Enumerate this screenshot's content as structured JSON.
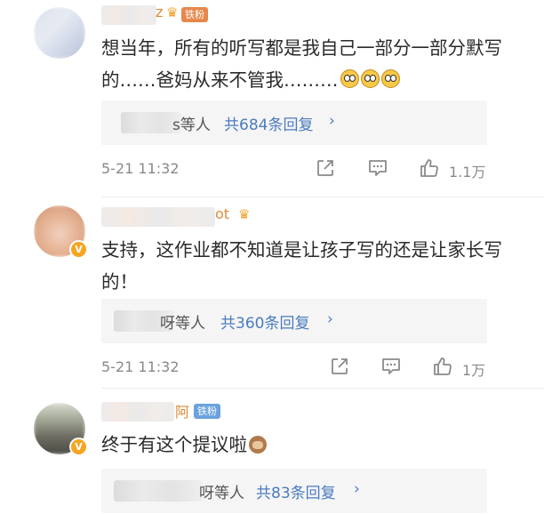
{
  "comments": [
    {
      "name_tail": "z",
      "fan_badge": "铁粉",
      "text": "想当年，所有的听写都是我自己一部分一部分默写的……爸妈从来不管我………",
      "reply_who_tail": "s等人",
      "reply_count": "共684条回复",
      "time": "5-21 11:32",
      "likes": "1.1万"
    },
    {
      "name_tail": "ot",
      "fan_badge": "",
      "text": "支持，这作业都不知道是让孩子写的还是让家长写的！",
      "reply_who_tail": "呀等人",
      "reply_count": "共360条回复",
      "time": "5-21 11:32",
      "likes": "1万"
    },
    {
      "name_tail": "阿",
      "fan_badge": "铁粉",
      "text": "终于有这个提议啦",
      "reply_who_tail": "呀等人",
      "reply_count": "共83条回复",
      "time": "",
      "likes": ""
    }
  ],
  "icons": {
    "share": "share-icon",
    "comment": "comment-icon",
    "like": "thumbs-up-icon",
    "chevron": "chevron-right-icon",
    "vip": "v-badge-icon",
    "crown": "crown-icon"
  },
  "colors": {
    "link": "#4a7bbf",
    "fan_badge_1": "#e6874b",
    "fan_badge_2": "#6aa2de",
    "vip": "#f5a623"
  }
}
